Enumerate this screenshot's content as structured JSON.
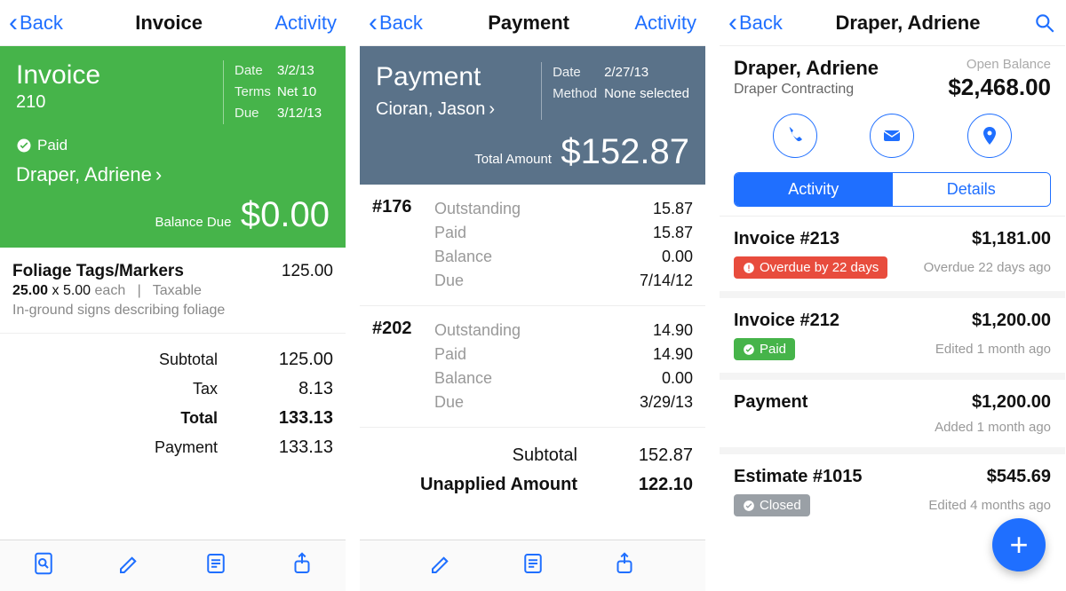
{
  "screen1": {
    "nav": {
      "back": "Back",
      "title": "Invoice",
      "right": "Activity"
    },
    "card": {
      "title": "Invoice",
      "number": "210",
      "date_label": "Date",
      "date_value": "3/2/13",
      "terms_label": "Terms",
      "terms_value": "Net 10",
      "due_label": "Due",
      "due_value": "3/12/13",
      "paid_label": "Paid",
      "customer": "Draper, Adriene",
      "balance_label": "Balance Due",
      "balance_amount": "$0.00"
    },
    "item": {
      "name": "Foliage Tags/Markers",
      "amount": "125.00",
      "qty": "25.00",
      "rate": "5.00",
      "each": "each",
      "sep": "|",
      "taxable": "Taxable",
      "desc": "In-ground signs describing foliage"
    },
    "totals": {
      "subtotal_label": "Subtotal",
      "subtotal_value": "125.00",
      "tax_label": "Tax",
      "tax_value": "8.13",
      "total_label": "Total",
      "total_value": "133.13",
      "payment_label": "Payment",
      "payment_value": "133.13"
    }
  },
  "screen2": {
    "nav": {
      "back": "Back",
      "title": "Payment",
      "right": "Activity"
    },
    "card": {
      "title": "Payment",
      "customer": "Cioran, Jason",
      "date_label": "Date",
      "date_value": "2/27/13",
      "method_label": "Method",
      "method_value": "None selected",
      "total_label": "Total Amount",
      "total_amount": "$152.87"
    },
    "entries": [
      {
        "id": "#176",
        "outstanding_label": "Outstanding",
        "outstanding_value": "15.87",
        "paid_label": "Paid",
        "paid_value": "15.87",
        "balance_label": "Balance",
        "balance_value": "0.00",
        "due_label": "Due",
        "due_value": "7/14/12"
      },
      {
        "id": "#202",
        "outstanding_label": "Outstanding",
        "outstanding_value": "14.90",
        "paid_label": "Paid",
        "paid_value": "14.90",
        "balance_label": "Balance",
        "balance_value": "0.00",
        "due_label": "Due",
        "due_value": "3/29/13"
      }
    ],
    "totals": {
      "subtotal_label": "Subtotal",
      "subtotal_value": "152.87",
      "unapplied_label": "Unapplied Amount",
      "unapplied_value": "122.10"
    }
  },
  "screen3": {
    "nav": {
      "back": "Back",
      "title": "Draper, Adriene"
    },
    "header": {
      "name": "Draper, Adriene",
      "company": "Draper Contracting",
      "open_balance_label": "Open Balance",
      "open_balance_value": "$2,468.00"
    },
    "tabs": {
      "activity": "Activity",
      "details": "Details"
    },
    "items": [
      {
        "title": "Invoice #213",
        "amount": "$1,181.00",
        "badge_color": "red",
        "badge_text": "Overdue by 22 days",
        "sub": "Overdue 22 days ago"
      },
      {
        "title": "Invoice #212",
        "amount": "$1,200.00",
        "badge_color": "green",
        "badge_text": "Paid",
        "sub": "Edited 1 month ago"
      },
      {
        "title": "Payment",
        "amount": "$1,200.00",
        "badge_color": "",
        "badge_text": "",
        "sub": "Added 1 month ago"
      },
      {
        "title": "Estimate #1015",
        "amount": "$545.69",
        "badge_color": "gray",
        "badge_text": "Closed",
        "sub": "Edited 4 months ago"
      }
    ]
  }
}
